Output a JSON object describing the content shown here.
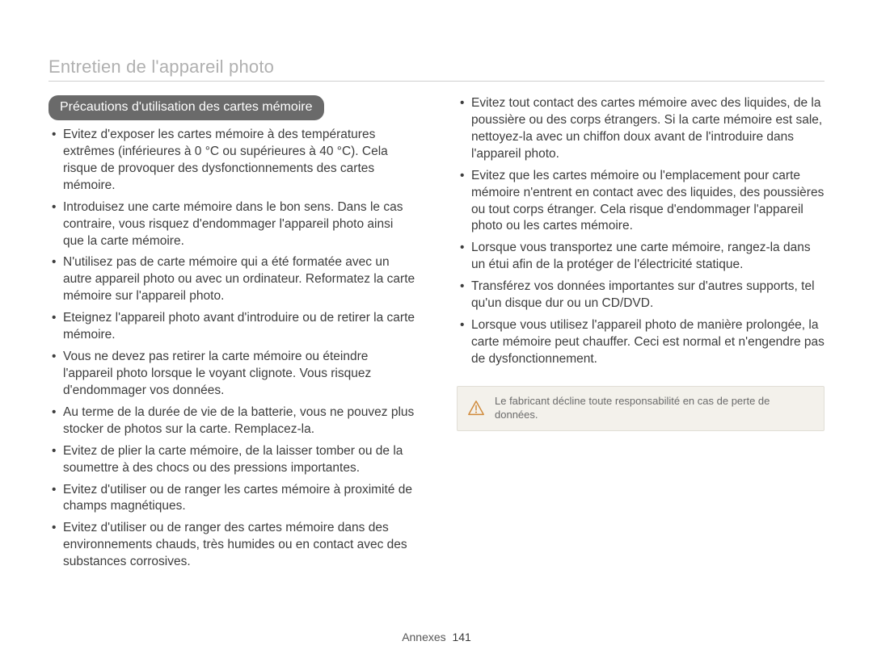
{
  "header": {
    "title": "Entretien de l'appareil photo"
  },
  "section": {
    "heading": "Précautions d'utilisation des cartes mémoire"
  },
  "left_bullets": [
    "Evitez d'exposer les cartes mémoire à des températures extrêmes (inférieures à 0 °C ou supérieures à 40 °C). Cela risque de provoquer des dysfonctionnements des cartes mémoire.",
    "Introduisez une carte mémoire dans le bon sens. Dans le cas contraire, vous risquez d'endommager l'appareil photo ainsi que la carte mémoire.",
    "N'utilisez pas de carte mémoire qui a été formatée avec un autre appareil photo ou avec un ordinateur. Reformatez la carte mémoire sur l'appareil photo.",
    "Eteignez l'appareil photo avant d'introduire ou de retirer la carte mémoire.",
    "Vous ne devez pas retirer la carte mémoire ou éteindre l'appareil photo lorsque le voyant clignote. Vous risquez d'endommager vos données.",
    "Au terme de la durée de vie de la batterie, vous ne pouvez plus stocker de photos sur la carte. Remplacez-la.",
    "Evitez de plier la carte mémoire, de la laisser tomber ou de la soumettre à des chocs ou des pressions importantes.",
    "Evitez d'utiliser ou de ranger les cartes mémoire à proximité de champs magnétiques.",
    "Evitez d'utiliser ou de ranger des cartes mémoire dans des environnements chauds, très humides ou en contact avec des substances corrosives."
  ],
  "right_bullets": [
    "Evitez tout contact des cartes mémoire avec des liquides, de la poussière ou des corps étrangers. Si la carte mémoire est sale, nettoyez-la avec un chiffon doux avant de l'introduire dans l'appareil photo.",
    "Evitez que les cartes mémoire ou l'emplacement pour carte mémoire n'entrent en contact avec des liquides, des poussières ou tout corps étranger. Cela risque d'endommager l'appareil photo ou les cartes mémoire.",
    "Lorsque vous transportez une carte mémoire, rangez-la dans un étui afin de la protéger de l'électricité statique.",
    "Transférez vos données importantes sur d'autres supports, tel qu'un disque dur ou un CD/DVD.",
    "Lorsque vous utilisez l'appareil photo de manière prolongée, la carte mémoire peut chauffer. Ceci est normal et n'engendre pas de dysfonctionnement."
  ],
  "note": {
    "text": "Le fabricant décline toute responsabilité en cas de perte de données."
  },
  "footer": {
    "section": "Annexes",
    "page": "141"
  }
}
